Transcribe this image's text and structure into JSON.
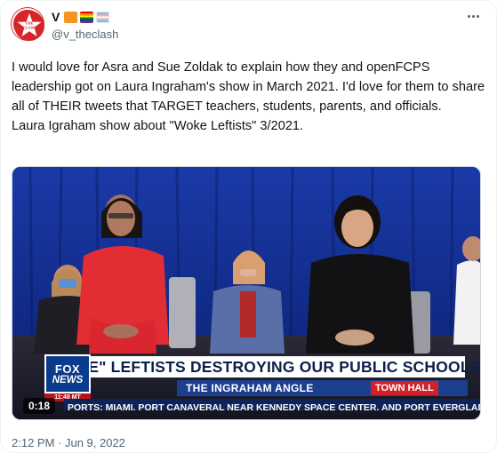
{
  "author": {
    "display_name": "V",
    "handle": "@v_theclash",
    "avatar_text": "THE CLASH",
    "name_emojis": [
      "orange-square-emoji",
      "rainbow-flag-emoji",
      "transgender-flag-emoji"
    ]
  },
  "tweet": {
    "text": "I would love for Asra and Sue Zoldak to explain how they and openFCPS leadership got on Laura Ingraham's show in March 2021. I'd love for them to share all of THEIR tweets that TARGET teachers, students, parents, and officials.\nLaura Igraham show about \"Woke Leftists\" 3/2021.",
    "timestamp": "2:12 PM · Jun 9, 2022"
  },
  "video": {
    "duration": "0:18",
    "chyron_headline": "\"WOKE\" LEFTISTS DESTROYING OUR PUBLIC SCHOOLS",
    "network_top": "FOX",
    "network_bottom": "NEWS",
    "network_time": "11:48 MT",
    "show_name": "THE INGRAHAM ANGLE",
    "segment_tag": "TOWN HALL",
    "crawl": "PORTS: MIAMI, PORT CANAVERAL NEAR KENNEDY SPACE CENTER, AND PORT EVERGLADES NEAR FORT"
  },
  "icons": {
    "more": "more-options-icon"
  },
  "colors": {
    "avatar_red": "#d6252a",
    "text_primary": "#0f1419",
    "text_secondary": "#536471",
    "fox_blue": "#0b3b8c",
    "town_hall_red": "#d0212b"
  }
}
